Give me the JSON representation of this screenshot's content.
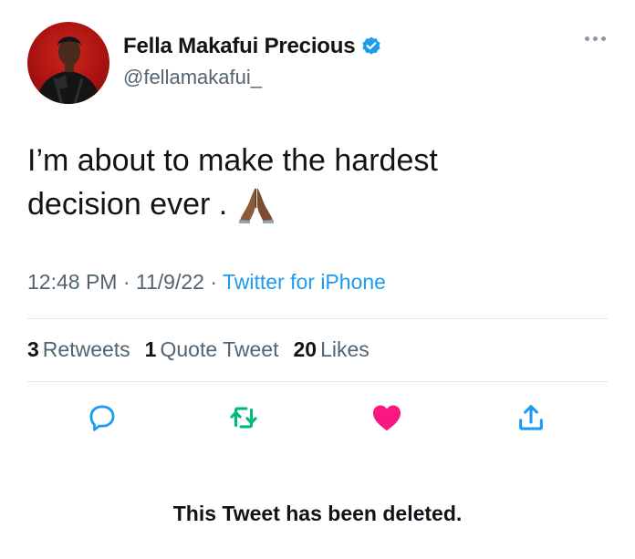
{
  "user": {
    "display_name": "Fella Makafui Precious",
    "handle": "@fellamakafui_",
    "verified": true
  },
  "tweet": {
    "text_line1": "I’m about to make the hardest",
    "text_line2": "decision ever .",
    "emoji": "folded-hands-icon"
  },
  "meta": {
    "time": "12:48 PM",
    "sep1": " · ",
    "date": "11/9/22",
    "sep2": " · ",
    "source": "Twitter for iPhone"
  },
  "stats": {
    "retweets_count": "3",
    "retweets_label": "Retweets",
    "quotes_count": "1",
    "quotes_label": "Quote Tweet",
    "likes_count": "20",
    "likes_label": "Likes"
  },
  "actions": [
    {
      "name": "reply-icon"
    },
    {
      "name": "retweet-icon"
    },
    {
      "name": "like-icon"
    },
    {
      "name": "share-icon"
    }
  ],
  "notice": "This Tweet has been deleted.",
  "colors": {
    "blue": "#1d9bf0",
    "green": "#00ba7c",
    "pink": "#f91880",
    "gray": "#536471",
    "text": "#0f1419"
  }
}
